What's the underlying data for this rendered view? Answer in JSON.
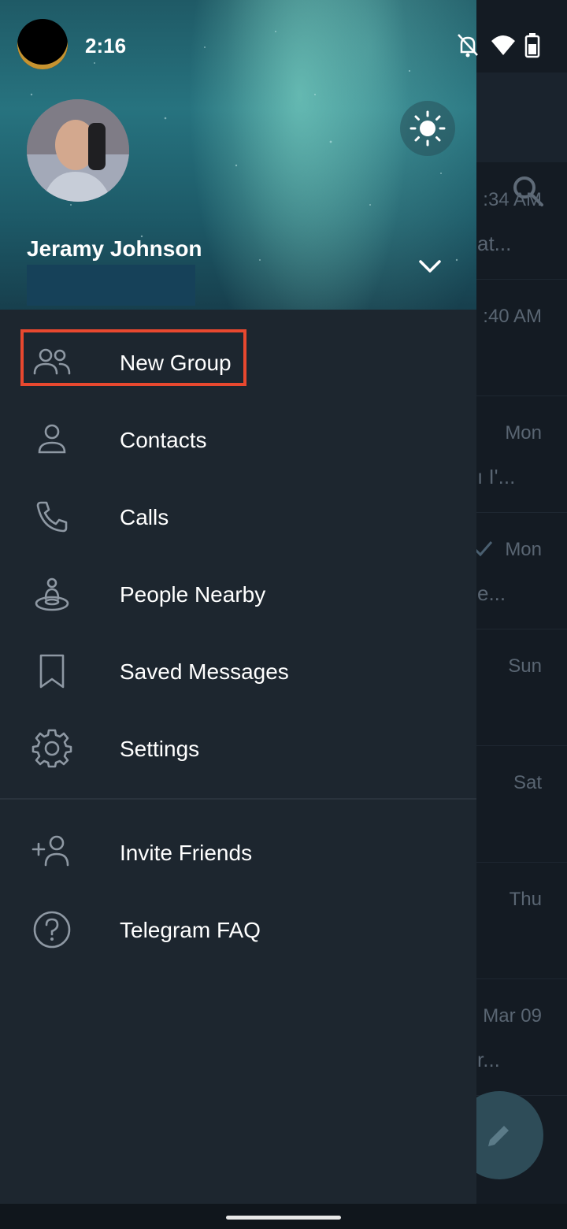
{
  "status_bar": {
    "time": "2:16",
    "icons": [
      "notifications-off-icon",
      "wifi-icon",
      "battery-icon"
    ]
  },
  "drawer": {
    "user": {
      "name": "Jeramy Johnson"
    },
    "menu": [
      {
        "label": "New Group",
        "icon": "new-group-icon",
        "highlighted": true
      },
      {
        "label": "Contacts",
        "icon": "contacts-icon"
      },
      {
        "label": "Calls",
        "icon": "phone-icon"
      },
      {
        "label": "People Nearby",
        "icon": "people-nearby-icon"
      },
      {
        "label": "Saved Messages",
        "icon": "bookmark-icon"
      },
      {
        "label": "Settings",
        "icon": "gear-icon"
      }
    ],
    "secondary_menu": [
      {
        "label": "Invite Friends",
        "icon": "add-person-icon"
      },
      {
        "label": "Telegram FAQ",
        "icon": "question-icon"
      }
    ]
  },
  "background_chats": [
    {
      "time": ":34 AM",
      "snippet": "at..."
    },
    {
      "time": ":40 AM",
      "snippet": ""
    },
    {
      "time": "Mon",
      "snippet": "ı I'..."
    },
    {
      "time": "Mon",
      "snippet": "e..."
    },
    {
      "time": "Sun",
      "snippet": ""
    },
    {
      "time": "Sat",
      "snippet": ""
    },
    {
      "time": "Thu",
      "snippet": ""
    },
    {
      "time": "Mar 09",
      "snippet": "r..."
    }
  ],
  "colors": {
    "drawer_bg": "#1d262f",
    "highlight": "#e8482f",
    "fab": "#2e4c58"
  }
}
